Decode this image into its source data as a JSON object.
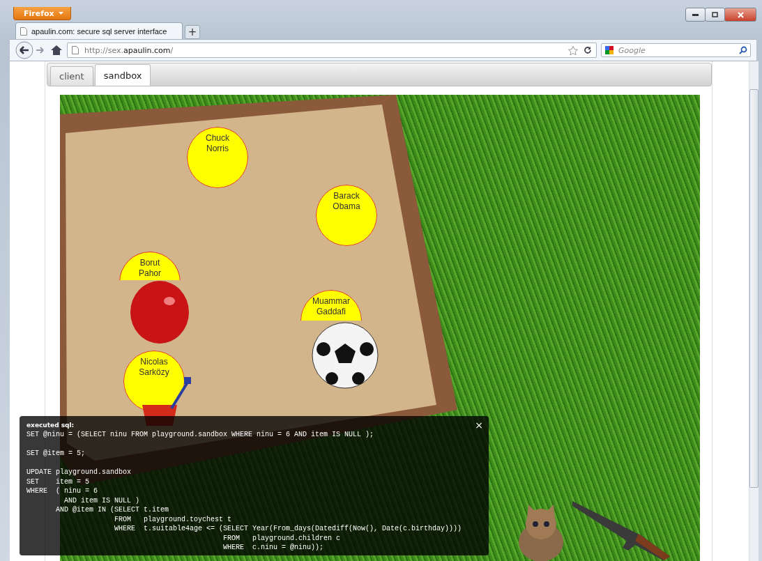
{
  "browser": {
    "app_button": "Firefox",
    "tab_title": "apaulin.com: secure sql server interface",
    "new_tab": "+",
    "url": "http://sex.**apaulin.com**/",
    "search_placeholder": "Google"
  },
  "page_tabs": [
    {
      "label": "client",
      "selected": false
    },
    {
      "label": "sandbox",
      "selected": true
    }
  ],
  "people": [
    {
      "name": "Chuck Norris"
    },
    {
      "name": "Barack Obama"
    },
    {
      "name": "Borut Pahor"
    },
    {
      "name": "Muammar Gaddafi"
    },
    {
      "name": "Nicolas Sarközy"
    }
  ],
  "sql_panel": {
    "title": "executed sql:",
    "close": "×",
    "code": "SET @ninu = (SELECT ninu FROM playground.sandbox WHERE ninu = 6 AND item IS NULL );\n\nSET @item = 5;\n\nUPDATE playground.sandbox\nSET    item = 5\nWHERE  ( ninu = 6\n         AND item IS NULL )\n       AND @item IN (SELECT t.item\n                     FROM   playground.toychest t\n                     WHERE  t.suitable4age <= (SELECT Year(From_days(Datediff(Now(), Date(c.birthday))))\n                                               FROM   playground.children c\n                                               WHERE  c.ninu = @ninu));"
  }
}
